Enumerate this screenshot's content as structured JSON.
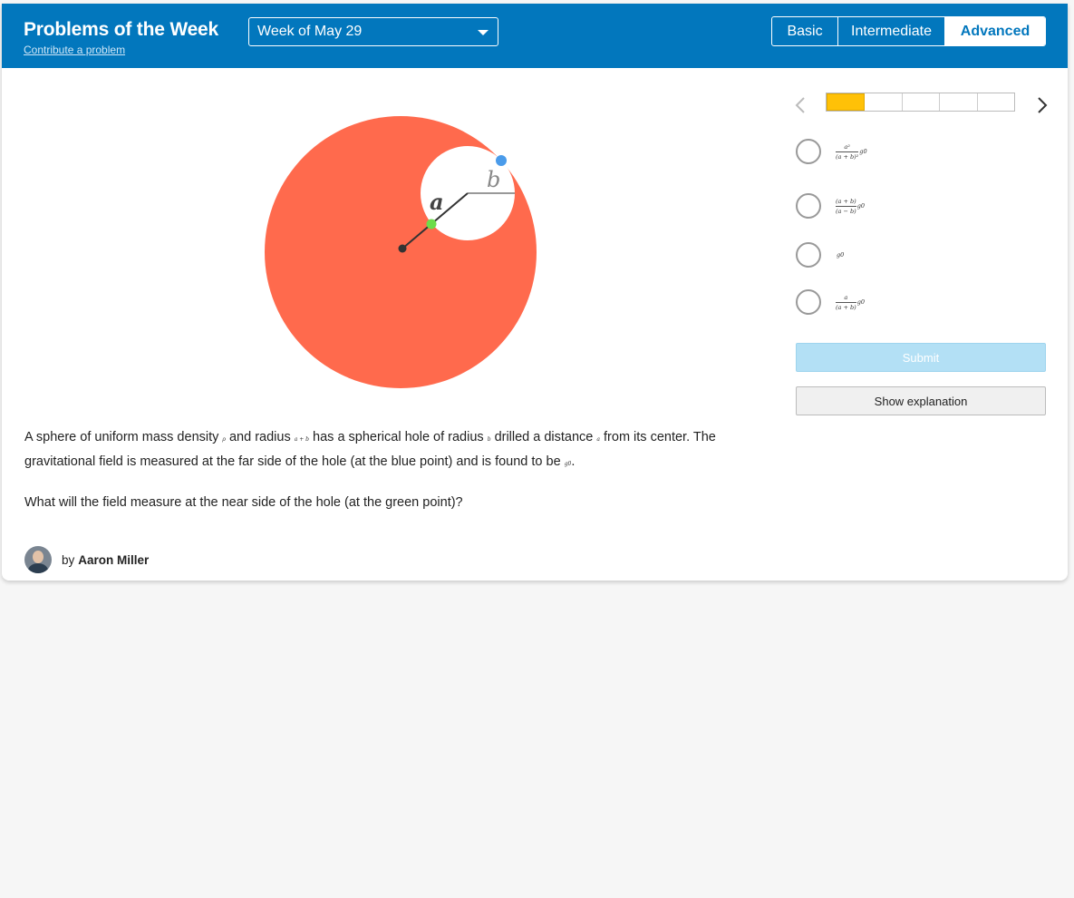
{
  "header": {
    "title": "Problems of the Week",
    "contribute_link": "Contribute a problem",
    "week_select": {
      "selected": "Week of May 29"
    },
    "levels": [
      {
        "label": "Basic",
        "active": false
      },
      {
        "label": "Intermediate",
        "active": false
      },
      {
        "label": "Advanced",
        "active": true
      }
    ],
    "brand_color": "#0277bd"
  },
  "figure": {
    "label_a": "a",
    "label_b": "b",
    "sphere_color": "#ff6a4d",
    "blue_point_color": "#4a9bea",
    "green_point_color": "#6ddc4a"
  },
  "problem": {
    "p1_part1": "A sphere of uniform mass density",
    "rho": "ρ",
    "p1_part2": "and radius",
    "a_plus_b": "a + b",
    "p1_part3": "has a spherical hole of radius",
    "b": "b",
    "p1_part4": "drilled a distance",
    "a": "a",
    "p1_part5": "from its center. The gravitational field is measured at the far side of the hole (at the blue point) and is found to be",
    "g0": "g0",
    "p1_end": ".",
    "question": "What will the field measure at the near side of the hole (at the green point)?"
  },
  "author": {
    "by": "by",
    "name": "Aaron Miller"
  },
  "progress": {
    "total": 5,
    "current": 1
  },
  "choices": [
    {
      "numerator": "a²",
      "denominator": "(a + b)²",
      "factor": "g0"
    },
    {
      "numerator": "(a + b)",
      "denominator": "(a − b)",
      "factor": "g0"
    },
    {
      "value": "g0"
    },
    {
      "numerator": "a",
      "denominator": "(a + b)",
      "factor": "g0"
    }
  ],
  "buttons": {
    "submit": "Submit",
    "explanation": "Show explanation"
  }
}
